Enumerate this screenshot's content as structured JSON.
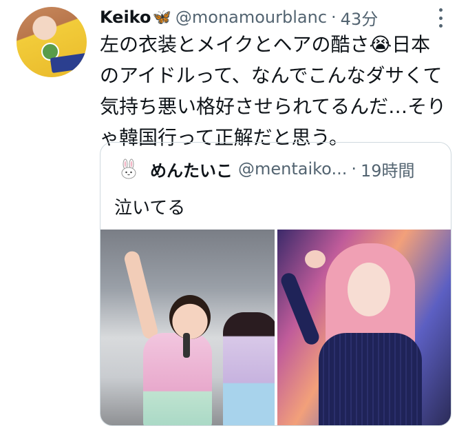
{
  "tweet": {
    "author_name": "Keiko",
    "author_badge_icon": "butterfly-emoji",
    "author_handle": "@monamourblanc",
    "separator": "·",
    "timestamp": "43分",
    "text_lines": [
      "左の衣装とメイクとヘアの酷さ😭日本",
      "のアイドルって、なんでこんなダサくて",
      "気持ち悪い格好させられてるんだ…そり",
      "ゃ韓国行って正解だと思う。"
    ]
  },
  "quote": {
    "author_name": "めんたいこ",
    "author_handle": "@mentaiko...",
    "separator": "·",
    "timestamp": "19時間",
    "text": "泣いてる",
    "media_count": 2
  },
  "colors": {
    "text_primary": "#0f1419",
    "text_secondary": "#536471",
    "border": "#cfd9de",
    "butterfly": "#3c8ddb"
  }
}
